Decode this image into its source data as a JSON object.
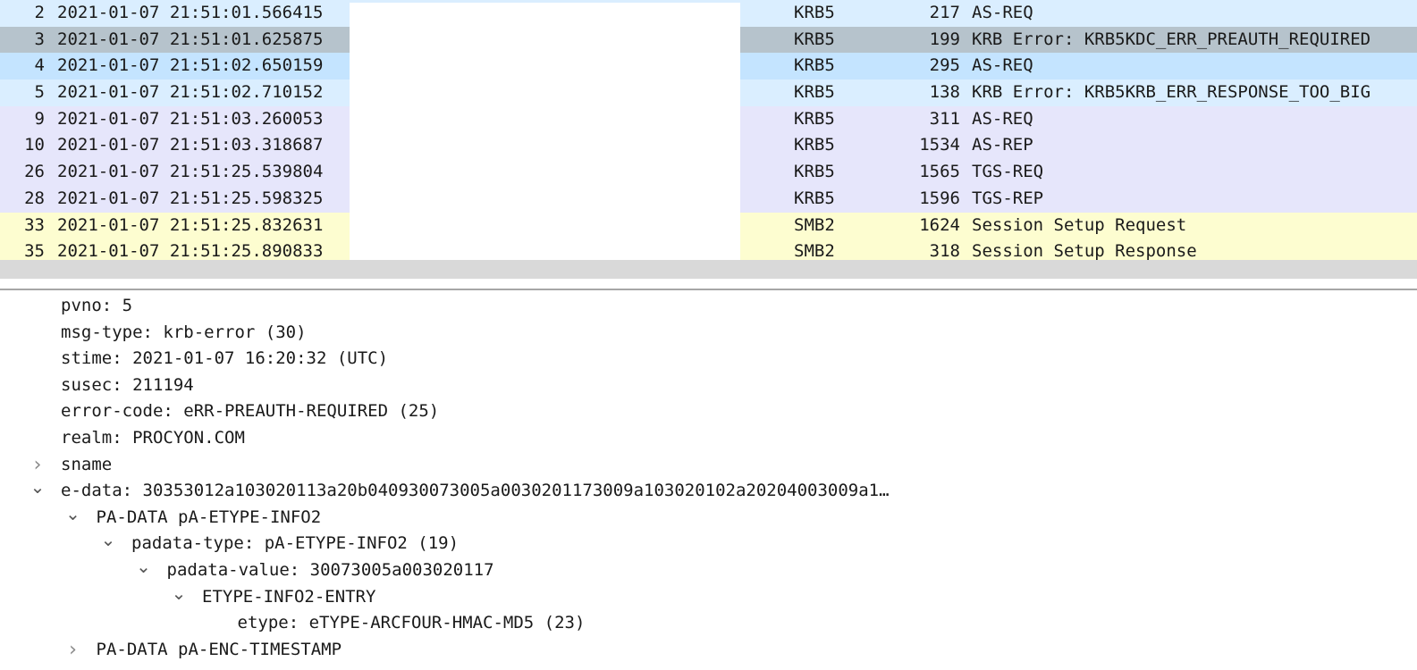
{
  "packet_list": {
    "rows": [
      {
        "no": "2",
        "time": "2021-01-07 21:51:01.566415",
        "protocol": "KRB5",
        "length": "217",
        "info": "AS-REQ",
        "bg": "#daeeff"
      },
      {
        "no": "3",
        "time": "2021-01-07 21:51:01.625875",
        "protocol": "KRB5",
        "length": "199",
        "info": "KRB Error: KRB5KDC_ERR_PREAUTH_REQUIRED",
        "bg": "#b6c3cc"
      },
      {
        "no": "4",
        "time": "2021-01-07 21:51:02.650159",
        "protocol": "KRB5",
        "length": "295",
        "info": "AS-REQ",
        "bg": "#c4e4ff"
      },
      {
        "no": "5",
        "time": "2021-01-07 21:51:02.710152",
        "protocol": "KRB5",
        "length": "138",
        "info": "KRB Error: KRB5KRB_ERR_RESPONSE_TOO_BIG",
        "bg": "#daeeff"
      },
      {
        "no": "9",
        "time": "2021-01-07 21:51:03.260053",
        "protocol": "KRB5",
        "length": "311",
        "info": "AS-REQ",
        "bg": "#e6e6fb"
      },
      {
        "no": "10",
        "time": "2021-01-07 21:51:03.318687",
        "protocol": "KRB5",
        "length": "1534",
        "info": "AS-REP",
        "bg": "#e6e6fb"
      },
      {
        "no": "26",
        "time": "2021-01-07 21:51:25.539804",
        "protocol": "KRB5",
        "length": "1565",
        "info": "TGS-REQ",
        "bg": "#e6e6fb"
      },
      {
        "no": "28",
        "time": "2021-01-07 21:51:25.598325",
        "protocol": "KRB5",
        "length": "1596",
        "info": "TGS-REP",
        "bg": "#e6e6fb"
      },
      {
        "no": "33",
        "time": "2021-01-07 21:51:25.832631",
        "protocol": "SMB2",
        "length": "1624",
        "info": "Session Setup Request",
        "bg": "#fdfdd0"
      },
      {
        "no": "35",
        "time": "2021-01-07 21:51:25.890833",
        "protocol": "SMB2",
        "length": "318",
        "info": "Session Setup Response",
        "bg": "#fdfdd0"
      }
    ]
  },
  "detail_tree": {
    "nodes": [
      {
        "text": "pvno: 5",
        "level": 0,
        "arrow": "none"
      },
      {
        "text": "msg-type: krb-error (30)",
        "level": 0,
        "arrow": "none"
      },
      {
        "text": "stime: 2021-01-07 16:20:32 (UTC)",
        "level": 0,
        "arrow": "none"
      },
      {
        "text": "susec: 211194",
        "level": 0,
        "arrow": "none"
      },
      {
        "text": "error-code: eRR-PREAUTH-REQUIRED (25)",
        "level": 0,
        "arrow": "none"
      },
      {
        "text": "realm: PROCYON.COM",
        "level": 0,
        "arrow": "none"
      },
      {
        "text": "sname",
        "level": 0,
        "arrow": "collapsed"
      },
      {
        "text": "e-data: 30353012a103020113a20b040930073005a0030201173009a103020102a20204003009a1…",
        "level": 0,
        "arrow": "expanded"
      },
      {
        "text": "PA-DATA pA-ETYPE-INFO2",
        "level": 1,
        "arrow": "expanded"
      },
      {
        "text": "padata-type: pA-ETYPE-INFO2 (19)",
        "level": 2,
        "arrow": "expanded"
      },
      {
        "text": "padata-value: 30073005a003020117",
        "level": 3,
        "arrow": "expanded"
      },
      {
        "text": "ETYPE-INFO2-ENTRY",
        "level": 4,
        "arrow": "expanded"
      },
      {
        "text": "etype: eTYPE-ARCFOUR-HMAC-MD5 (23)",
        "level": 5,
        "arrow": "none"
      },
      {
        "text": "PA-DATA pA-ENC-TIMESTAMP",
        "level": 1,
        "arrow": "collapsed"
      }
    ]
  },
  "icons": {
    "expanded": "chevron-down-icon",
    "collapsed": "chevron-right-icon"
  }
}
